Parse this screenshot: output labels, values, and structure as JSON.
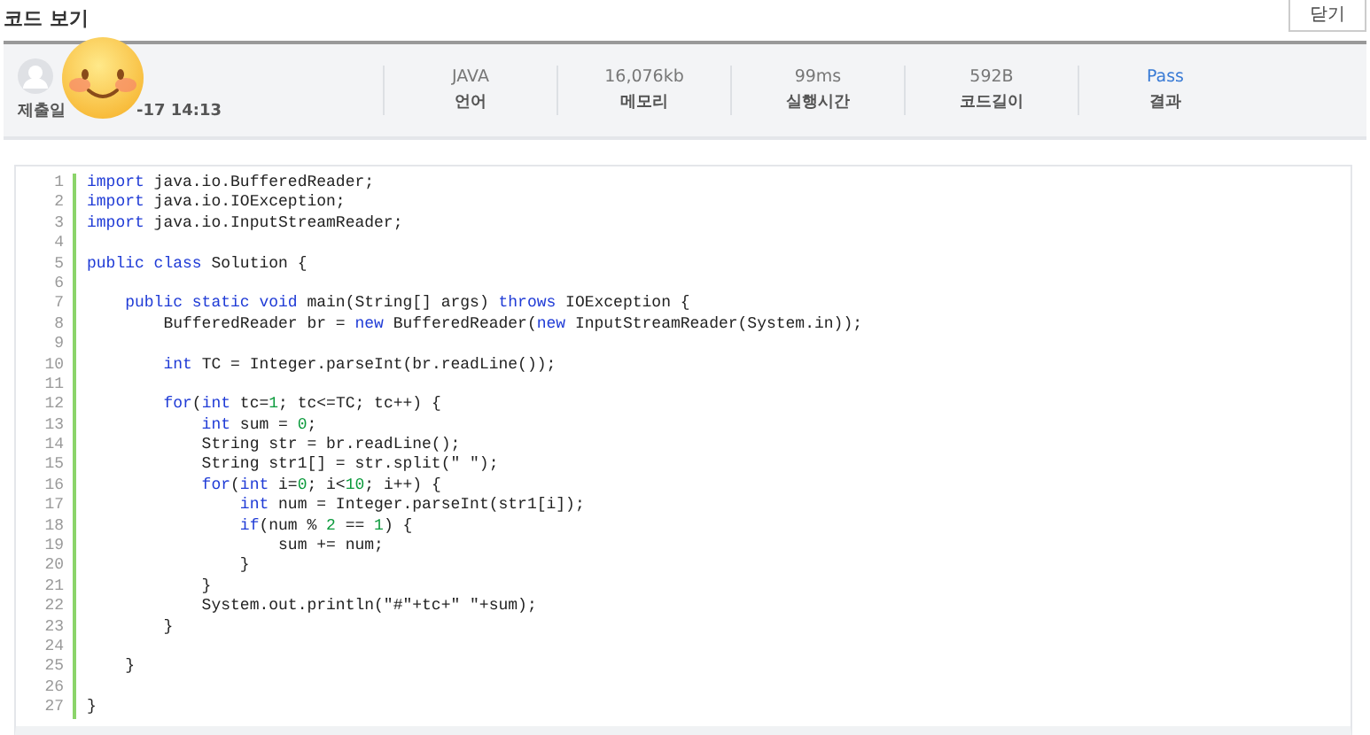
{
  "title": "코드 보기",
  "close_button": "닫기",
  "submission": {
    "date_label": "제출일",
    "date": "-17 14:13"
  },
  "stats": [
    {
      "kind": "metric",
      "value": "JAVA",
      "label": "언어"
    },
    {
      "kind": "metric",
      "value": "16,076kb",
      "label": "메모리"
    },
    {
      "kind": "metric",
      "value": "99ms",
      "label": "실행시간"
    },
    {
      "kind": "metric",
      "value": "592B",
      "label": "코드길이"
    },
    {
      "kind": "result",
      "value": "Pass",
      "label": "결과"
    }
  ],
  "code": [
    {
      "no": "1",
      "tokens": [
        {
          "kind": "keyword",
          "text": "import"
        },
        {
          "kind": "plain",
          "text": " java.io.BufferedReader;"
        }
      ]
    },
    {
      "no": "2",
      "tokens": [
        {
          "kind": "keyword",
          "text": "import"
        },
        {
          "kind": "plain",
          "text": " java.io.IOException;"
        }
      ]
    },
    {
      "no": "3",
      "tokens": [
        {
          "kind": "keyword",
          "text": "import"
        },
        {
          "kind": "plain",
          "text": " java.io.InputStreamReader;"
        }
      ]
    },
    {
      "no": "4"
    },
    {
      "no": "5",
      "tokens": [
        {
          "kind": "keyword",
          "text": "public class"
        },
        {
          "kind": "plain",
          "text": " Solution {"
        }
      ]
    },
    {
      "no": "6"
    },
    {
      "no": "7",
      "tokens": [
        {
          "kind": "keyword",
          "text": "    public static void"
        },
        {
          "kind": "plain",
          "text": " main(String[] args) "
        },
        {
          "kind": "keyword",
          "text": "throws"
        },
        {
          "kind": "plain",
          "text": " IOException {"
        }
      ]
    },
    {
      "no": "8",
      "tokens": [
        {
          "kind": "plain",
          "text": "        BufferedReader br = "
        },
        {
          "kind": "keyword",
          "text": "new"
        },
        {
          "kind": "plain",
          "text": " BufferedReader("
        },
        {
          "kind": "keyword",
          "text": "new"
        },
        {
          "kind": "plain",
          "text": " InputStreamReader(System.in));"
        }
      ]
    },
    {
      "no": "9"
    },
    {
      "no": "10",
      "tokens": [
        {
          "kind": "keyword",
          "text": "        int"
        },
        {
          "kind": "plain",
          "text": " TC = Integer.parseInt(br.readLine());"
        }
      ]
    },
    {
      "no": "11"
    },
    {
      "no": "12",
      "tokens": [
        {
          "kind": "keyword",
          "text": "        for"
        },
        {
          "kind": "plain",
          "text": "("
        },
        {
          "kind": "keyword",
          "text": "int"
        },
        {
          "kind": "plain",
          "text": " tc="
        },
        {
          "kind": "number",
          "text": "1"
        },
        {
          "kind": "plain",
          "text": "; tc<=TC; tc++) {"
        }
      ]
    },
    {
      "no": "13",
      "tokens": [
        {
          "kind": "keyword",
          "text": "            int"
        },
        {
          "kind": "plain",
          "text": " sum = "
        },
        {
          "kind": "number",
          "text": "0"
        },
        {
          "kind": "plain",
          "text": ";"
        }
      ]
    },
    {
      "no": "14",
      "tokens": [
        {
          "kind": "plain",
          "text": "            String str = br.readLine();"
        }
      ]
    },
    {
      "no": "15",
      "tokens": [
        {
          "kind": "plain",
          "text": "            String str1[] = str.split(\" \");"
        }
      ]
    },
    {
      "no": "16",
      "tokens": [
        {
          "kind": "keyword",
          "text": "            for"
        },
        {
          "kind": "plain",
          "text": "("
        },
        {
          "kind": "keyword",
          "text": "int"
        },
        {
          "kind": "plain",
          "text": " i="
        },
        {
          "kind": "number",
          "text": "0"
        },
        {
          "kind": "plain",
          "text": "; i<"
        },
        {
          "kind": "number",
          "text": "10"
        },
        {
          "kind": "plain",
          "text": "; i++) {"
        }
      ]
    },
    {
      "no": "17",
      "tokens": [
        {
          "kind": "keyword",
          "text": "                int"
        },
        {
          "kind": "plain",
          "text": " num = Integer.parseInt(str1[i]);"
        }
      ]
    },
    {
      "no": "18",
      "tokens": [
        {
          "kind": "keyword",
          "text": "                if"
        },
        {
          "kind": "plain",
          "text": "(num % "
        },
        {
          "kind": "number",
          "text": "2"
        },
        {
          "kind": "plain",
          "text": " == "
        },
        {
          "kind": "number",
          "text": "1"
        },
        {
          "kind": "plain",
          "text": ") {"
        }
      ]
    },
    {
      "no": "19",
      "tokens": [
        {
          "kind": "plain",
          "text": "                    sum += num;"
        }
      ]
    },
    {
      "no": "20",
      "tokens": [
        {
          "kind": "plain",
          "text": "                }"
        }
      ]
    },
    {
      "no": "21",
      "tokens": [
        {
          "kind": "plain",
          "text": "            }"
        }
      ]
    },
    {
      "no": "22",
      "tokens": [
        {
          "kind": "plain",
          "text": "            System.out.println(\"#\"+tc+\" \"+sum);"
        }
      ]
    },
    {
      "no": "23",
      "tokens": [
        {
          "kind": "plain",
          "text": "        }"
        }
      ]
    },
    {
      "no": "24"
    },
    {
      "no": "25",
      "tokens": [
        {
          "kind": "plain",
          "text": "    }"
        }
      ]
    },
    {
      "no": "26"
    },
    {
      "no": "27",
      "tokens": [
        {
          "kind": "plain",
          "text": "}"
        }
      ]
    }
  ]
}
